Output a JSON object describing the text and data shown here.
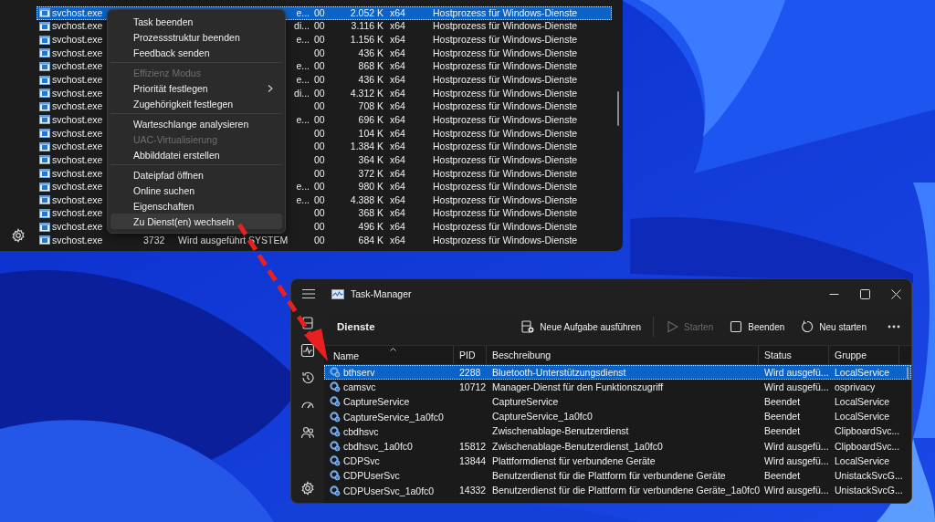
{
  "process_window": {
    "rows": [
      {
        "kind": "covered",
        "name": "svchost.exe",
        "user": "e...",
        "cpu": "00",
        "memory": "2.052 K",
        "arch": "x64",
        "description": "Hostprozess für Windows-Dienste",
        "selected": true
      },
      {
        "kind": "covered",
        "name": "svchost.exe",
        "user": "di...",
        "cpu": "00",
        "memory": "3.116 K",
        "arch": "x64",
        "description": "Hostprozess für Windows-Dienste",
        "selected": false
      },
      {
        "kind": "covered",
        "name": "svchost.exe",
        "user": "e...",
        "cpu": "00",
        "memory": "1.156 K",
        "arch": "x64",
        "description": "Hostprozess für Windows-Dienste",
        "selected": false
      },
      {
        "kind": "covered",
        "name": "svchost.exe",
        "cpu": "00",
        "memory": "436 K",
        "arch": "x64",
        "description": "Hostprozess für Windows-Dienste",
        "selected": false
      },
      {
        "kind": "covered",
        "name": "svchost.exe",
        "user": "e...",
        "cpu": "00",
        "memory": "868 K",
        "arch": "x64",
        "description": "Hostprozess für Windows-Dienste",
        "selected": false
      },
      {
        "kind": "covered",
        "name": "svchost.exe",
        "user": "e...",
        "cpu": "00",
        "memory": "436 K",
        "arch": "x64",
        "description": "Hostprozess für Windows-Dienste",
        "selected": false
      },
      {
        "kind": "covered",
        "name": "svchost.exe",
        "user": "di...",
        "cpu": "00",
        "memory": "4.312 K",
        "arch": "x64",
        "description": "Hostprozess für Windows-Dienste",
        "selected": false
      },
      {
        "kind": "covered",
        "name": "svchost.exe",
        "cpu": "00",
        "memory": "708 K",
        "arch": "x64",
        "description": "Hostprozess für Windows-Dienste",
        "selected": false
      },
      {
        "kind": "covered",
        "name": "svchost.exe",
        "user": "e...",
        "cpu": "00",
        "memory": "696 K",
        "arch": "x64",
        "description": "Hostprozess für Windows-Dienste",
        "selected": false
      },
      {
        "kind": "covered",
        "name": "svchost.exe",
        "cpu": "00",
        "memory": "104 K",
        "arch": "x64",
        "description": "Hostprozess für Windows-Dienste",
        "selected": false
      },
      {
        "kind": "covered",
        "name": "svchost.exe",
        "cpu": "00",
        "memory": "1.384 K",
        "arch": "x64",
        "description": "Hostprozess für Windows-Dienste",
        "selected": false
      },
      {
        "kind": "covered",
        "name": "svchost.exe",
        "cpu": "00",
        "memory": "364 K",
        "arch": "x64",
        "description": "Hostprozess für Windows-Dienste",
        "selected": false
      },
      {
        "kind": "covered",
        "name": "svchost.exe",
        "cpu": "00",
        "memory": "372 K",
        "arch": "x64",
        "description": "Hostprozess für Windows-Dienste",
        "selected": false
      },
      {
        "kind": "covered",
        "name": "svchost.exe",
        "user": "e...",
        "cpu": "00",
        "memory": "980 K",
        "arch": "x64",
        "description": "Hostprozess für Windows-Dienste",
        "selected": false
      },
      {
        "kind": "covered",
        "name": "svchost.exe",
        "user": "e...",
        "cpu": "00",
        "memory": "4.388 K",
        "arch": "x64",
        "description": "Hostprozess für Windows-Dienste",
        "selected": false
      },
      {
        "kind": "covered",
        "name": "svchost.exe",
        "cpu": "00",
        "memory": "368 K",
        "arch": "x64",
        "description": "Hostprozess für Windows-Dienste",
        "selected": false
      },
      {
        "kind": "covered",
        "name": "svchost.exe",
        "cpu": "00",
        "memory": "496 K",
        "arch": "x64",
        "description": "Hostprozess für Windows-Dienste",
        "selected": false
      },
      {
        "kind": "full",
        "name": "svchost.exe",
        "pid": "3732",
        "status": "Wird ausgeführt",
        "user": "SYSTEM",
        "cpu": "00",
        "memory": "684 K",
        "arch": "x64",
        "description": "Hostprozess für Windows-Dienste",
        "selected": false
      }
    ]
  },
  "context_menu": {
    "groups": [
      [
        {
          "label": "Task beenden",
          "disabled": false,
          "submenu": false,
          "highlighted": false
        },
        {
          "label": "Prozessstruktur beenden",
          "disabled": false,
          "submenu": false,
          "highlighted": false
        },
        {
          "label": "Feedback senden",
          "disabled": false,
          "submenu": false,
          "highlighted": false
        }
      ],
      [
        {
          "label": "Effizienz Modus",
          "disabled": true,
          "submenu": false,
          "highlighted": false
        },
        {
          "label": "Priorität festlegen",
          "disabled": false,
          "submenu": true,
          "highlighted": false
        },
        {
          "label": "Zugehörigkeit festlegen",
          "disabled": false,
          "submenu": false,
          "highlighted": false
        }
      ],
      [
        {
          "label": "Warteschlange analysieren",
          "disabled": false,
          "submenu": false,
          "highlighted": false
        },
        {
          "label": "UAC-Virtualisierung",
          "disabled": true,
          "submenu": false,
          "highlighted": false
        },
        {
          "label": "Abbilddatei erstellen",
          "disabled": false,
          "submenu": false,
          "highlighted": false
        }
      ],
      [
        {
          "label": "Dateipfad öffnen",
          "disabled": false,
          "submenu": false,
          "highlighted": false
        },
        {
          "label": "Online suchen",
          "disabled": false,
          "submenu": false,
          "highlighted": false
        },
        {
          "label": "Eigenschaften",
          "disabled": false,
          "submenu": false,
          "highlighted": false
        },
        {
          "label": "Zu Dienst(en) wechseln",
          "disabled": false,
          "submenu": false,
          "highlighted": true
        }
      ]
    ]
  },
  "services_window": {
    "title": "Task-Manager",
    "page_title": "Dienste",
    "toolbar": [
      {
        "kind": "new-task",
        "label": "Neue Aufgabe ausführen",
        "disabled": false
      },
      {
        "kind": "start",
        "label": "Starten",
        "disabled": true
      },
      {
        "kind": "stop",
        "label": "Beenden",
        "disabled": false
      },
      {
        "kind": "restart",
        "label": "Neu starten",
        "disabled": false
      }
    ],
    "columns": [
      {
        "label": "Name",
        "sorted": true
      },
      {
        "label": "PID",
        "sorted": false
      },
      {
        "label": "Beschreibung",
        "sorted": false
      },
      {
        "label": "Status",
        "sorted": false
      },
      {
        "label": "Gruppe",
        "sorted": false
      }
    ],
    "rows": [
      {
        "name": "bthserv",
        "pid": "2288",
        "description": "Bluetooth-Unterstützungsdienst",
        "status": "Wird ausgefü...",
        "group": "LocalService",
        "selected": true
      },
      {
        "name": "camsvc",
        "pid": "10712",
        "description": "Manager-Dienst für den Funktionszugriff",
        "status": "Wird ausgefü...",
        "group": "osprivacy",
        "selected": false
      },
      {
        "name": "CaptureService",
        "description": "CaptureService",
        "status": "Beendet",
        "group": "LocalService",
        "selected": false
      },
      {
        "name": "CaptureService_1a0fc0",
        "description": "CaptureService_1a0fc0",
        "status": "Beendet",
        "group": "LocalService",
        "selected": false
      },
      {
        "name": "cbdhsvc",
        "description": "Zwischenablage-Benutzerdienst",
        "status": "Beendet",
        "group": "ClipboardSvc...",
        "selected": false
      },
      {
        "name": "cbdhsvc_1a0fc0",
        "pid": "15812",
        "description": "Zwischenablage-Benutzerdienst_1a0fc0",
        "status": "Wird ausgefü...",
        "group": "ClipboardSvc...",
        "selected": false
      },
      {
        "name": "CDPSvc",
        "pid": "13844",
        "description": "Plattformdienst für verbundene Geräte",
        "status": "Wird ausgefü...",
        "group": "LocalService",
        "selected": false
      },
      {
        "name": "CDPUserSvc",
        "description": "Benutzerdienst für die Plattform für verbundene Geräte",
        "status": "Beendet",
        "group": "UnistackSvcG...",
        "selected": false
      },
      {
        "name": "CDPUserSvc_1a0fc0",
        "pid": "14332",
        "description": "Benutzerdienst für die Plattform für verbundene Geräte_1a0fc0",
        "status": "Wird ausgefü...",
        "group": "UnistackSvcG...",
        "selected": false
      }
    ]
  }
}
